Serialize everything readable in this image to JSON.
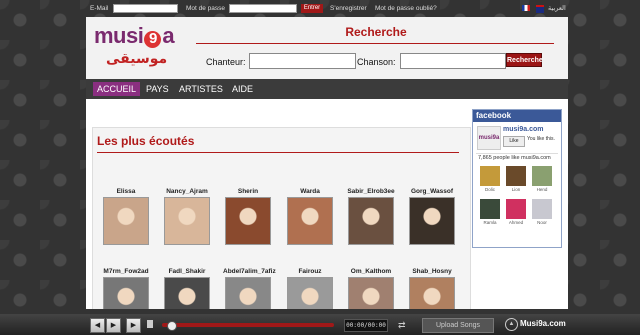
{
  "topbar": {
    "email_label": "E-Mail",
    "password_label": "Mot de passe",
    "enter_button": "Entrer",
    "register_link": "S'enregistrer",
    "forgot_link": "Mot de passe oublié?",
    "lang_ar": "العربية"
  },
  "header": {
    "logo_prefix": "musi",
    "logo_nine": "9",
    "logo_suffix": "a",
    "logo_arabic": "موسيقى",
    "search_title": "Recherche",
    "singer_label": "Chanteur:",
    "song_label": "Chanson:",
    "search_button": "Recherche"
  },
  "nav": {
    "items": [
      "ACCUEIL",
      "PAYS",
      "ARTISTES",
      "AIDE"
    ]
  },
  "section": {
    "title": "Les plus écoutés"
  },
  "artists": [
    {
      "name": "Elissa",
      "color": "#c9a58a"
    },
    {
      "name": "Nancy_Ajram",
      "color": "#d8b69a"
    },
    {
      "name": "Sherin",
      "color": "#8a4a2e"
    },
    {
      "name": "Warda",
      "color": "#b07050"
    },
    {
      "name": "Sabir_Elrob3ee",
      "color": "#6a5040"
    },
    {
      "name": "Gorg_Wassof",
      "color": "#3a3028"
    },
    {
      "name": "M7rm_Fow2ad",
      "color": "#777777"
    },
    {
      "name": "Fadl_Shakir",
      "color": "#4a4a4a"
    },
    {
      "name": "Abdel7alim_7afiz",
      "color": "#888888"
    },
    {
      "name": "Fairouz",
      "color": "#9a9a9a"
    },
    {
      "name": "Om_Kalthom",
      "color": "#a08070"
    },
    {
      "name": "Shab_Hosny",
      "color": "#b08060"
    }
  ],
  "facebook": {
    "header": "facebook",
    "page_name": "musi9a.com",
    "like_button": "Like",
    "you_like": "You like this.",
    "count_text": "7,865 people like musi9a.com",
    "fans": [
      {
        "name": "Dolic",
        "color": "#c49a3a"
      },
      {
        "name": "Lion",
        "color": "#6a4a2a"
      },
      {
        "name": "Hend",
        "color": "#8aa070"
      },
      {
        "name": "Ramla",
        "color": "#3a4a3a"
      },
      {
        "name": "Ahmed",
        "color": "#d03060"
      },
      {
        "name": "Noor",
        "color": "#c8c8d0"
      }
    ]
  },
  "player": {
    "prev_icon": "◀",
    "play_icon": "▶",
    "next_icon": "▶",
    "time": "00:00/00:00",
    "upload_label": "Upload Songs",
    "brand": "Musi9a.com",
    "progress_fraction": 0.03
  }
}
